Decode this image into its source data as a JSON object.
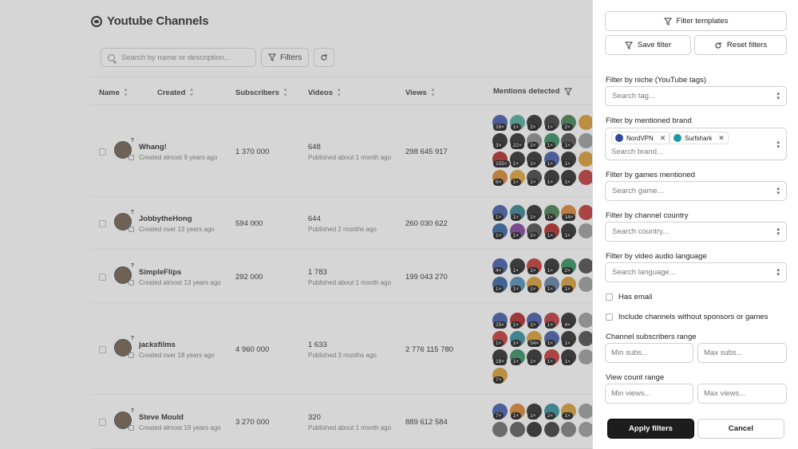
{
  "page": {
    "title": "Youtube Channels"
  },
  "toolbar": {
    "search_placeholder": "Search by name or description...",
    "filters_label": "Filters"
  },
  "table": {
    "headers": {
      "name": "Name",
      "created": "Created",
      "subscribers": "Subscribers",
      "videos": "Videos",
      "views": "Views",
      "mentions": "Mentions detected"
    },
    "rows": [
      {
        "name": "Whang!",
        "created": "Created almost 9 years ago",
        "subscribers": "1 370 000",
        "videos": "648",
        "videos_sub": "Published about 1 month ago",
        "views": "298 645 917",
        "mentions": [
          {
            "c": "#3a55a6",
            "n": "26"
          },
          {
            "c": "#4aa89a",
            "n": "1"
          },
          {
            "c": "#222",
            "n": "2"
          },
          {
            "c": "#333",
            "n": "1"
          },
          {
            "c": "#3d7a4a",
            "n": "2"
          },
          {
            "c": "#d79a2b",
            "n": ""
          },
          {
            "c": "#222",
            "n": "3"
          },
          {
            "c": "#222",
            "n": "22"
          },
          {
            "c": "#888",
            "n": "1"
          },
          {
            "c": "#2a8a5a",
            "n": "1"
          },
          {
            "c": "#444",
            "n": "1"
          },
          {
            "c": "#999",
            "n": ""
          },
          {
            "c": "#b01e1e",
            "n": "155"
          },
          {
            "c": "#222",
            "n": "1"
          },
          {
            "c": "#222",
            "n": "1"
          },
          {
            "c": "#3a55a6",
            "n": "1"
          },
          {
            "c": "#222",
            "n": "1"
          },
          {
            "c": "#d79a2b",
            "n": ""
          },
          {
            "c": "#d8802a",
            "n": "6"
          },
          {
            "c": "#e0a030",
            "n": "1"
          },
          {
            "c": "#3a3a3a",
            "n": "1"
          },
          {
            "c": "#222",
            "n": "1"
          },
          {
            "c": "#222",
            "n": "1"
          },
          {
            "c": "#c23030",
            "n": ""
          }
        ]
      },
      {
        "name": "JobbytheHong",
        "created": "Created over 13 years ago",
        "subscribers": "594 000",
        "videos": "644",
        "videos_sub": "Published 2 months ago",
        "views": "260 030 622",
        "mentions": [
          {
            "c": "#3a55a6",
            "n": "1"
          },
          {
            "c": "#2c7c8c",
            "n": "1"
          },
          {
            "c": "#222",
            "n": "1"
          },
          {
            "c": "#3d7a4a",
            "n": "1"
          },
          {
            "c": "#d8802a",
            "n": "14"
          },
          {
            "c": "#c23030",
            "n": ""
          },
          {
            "c": "#2c5c9c",
            "n": "1"
          },
          {
            "c": "#7a3a9a",
            "n": "1"
          },
          {
            "c": "#444",
            "n": "1"
          },
          {
            "c": "#b01e1e",
            "n": "1"
          },
          {
            "c": "#222",
            "n": "1"
          },
          {
            "c": "#999",
            "n": ""
          }
        ]
      },
      {
        "name": "SimpleFlips",
        "created": "Created almost 13 years ago",
        "subscribers": "292 000",
        "videos": "1 783",
        "videos_sub": "Published about 1 month ago",
        "views": "199 043 270",
        "mentions": [
          {
            "c": "#3a55a6",
            "n": "4"
          },
          {
            "c": "#222",
            "n": "1"
          },
          {
            "c": "#c23030",
            "n": "1"
          },
          {
            "c": "#222",
            "n": "1"
          },
          {
            "c": "#2a8a5a",
            "n": "2"
          },
          {
            "c": "#444",
            "n": ""
          },
          {
            "c": "#2c5c9c",
            "n": "1"
          },
          {
            "c": "#4a8ab0",
            "n": "1"
          },
          {
            "c": "#d79a2b",
            "n": "1"
          },
          {
            "c": "#5a7aa0",
            "n": "1"
          },
          {
            "c": "#d79a2b",
            "n": "1"
          },
          {
            "c": "#999",
            "n": ""
          }
        ]
      },
      {
        "name": "jacksfilms",
        "created": "Created over 18 years ago",
        "subscribers": "4 960 000",
        "videos": "1 633",
        "videos_sub": "Published 3 months ago",
        "views": "2 776 115 780",
        "mentions": [
          {
            "c": "#3a55a6",
            "n": "25"
          },
          {
            "c": "#b01e1e",
            "n": "1"
          },
          {
            "c": "#3a55a6",
            "n": "1"
          },
          {
            "c": "#c23030",
            "n": "1"
          },
          {
            "c": "#222",
            "n": "4"
          },
          {
            "c": "#999",
            "n": ""
          },
          {
            "c": "#c23030",
            "n": "1"
          },
          {
            "c": "#2a8a9a",
            "n": "1"
          },
          {
            "c": "#d79a2b",
            "n": "54"
          },
          {
            "c": "#3a55a6",
            "n": "1"
          },
          {
            "c": "#222",
            "n": "1"
          },
          {
            "c": "#444",
            "n": ""
          },
          {
            "c": "#222",
            "n": "18"
          },
          {
            "c": "#2a8a5a",
            "n": "1"
          },
          {
            "c": "#222",
            "n": "1"
          },
          {
            "c": "#c23030",
            "n": "1"
          },
          {
            "c": "#222",
            "n": "1"
          },
          {
            "c": "#999",
            "n": ""
          },
          {
            "c": "#d79a2b",
            "n": "7"
          }
        ]
      },
      {
        "name": "Steve Mould",
        "created": "Created almost 19 years ago",
        "subscribers": "3 270 000",
        "videos": "320",
        "videos_sub": "Published about 1 month ago",
        "views": "889 612 584",
        "mentions": [
          {
            "c": "#3a55a6",
            "n": "7"
          },
          {
            "c": "#d8802a",
            "n": "1"
          },
          {
            "c": "#222",
            "n": "1"
          },
          {
            "c": "#2a8a9a",
            "n": "2"
          },
          {
            "c": "#d79a2b",
            "n": "1"
          },
          {
            "c": "#999",
            "n": ""
          },
          {
            "c": "#666",
            "n": ""
          },
          {
            "c": "#555",
            "n": ""
          },
          {
            "c": "#222",
            "n": ""
          },
          {
            "c": "#333",
            "n": ""
          },
          {
            "c": "#777",
            "n": ""
          },
          {
            "c": "#999",
            "n": ""
          }
        ]
      }
    ]
  },
  "panel": {
    "templates_label": "Filter templates",
    "save_label": "Save filter",
    "reset_label": "Reset filters",
    "niche_label": "Filter by niche (YouTube tags)",
    "niche_placeholder": "Search tag...",
    "brand_label": "Filter by mentioned brand",
    "brand_chips": [
      {
        "name": "NordVPN",
        "color": "#2d4aa0"
      },
      {
        "name": "Surfshark",
        "color": "#1c9aa6"
      }
    ],
    "brand_placeholder": "Search brand...",
    "games_label": "Filter by games mentioned",
    "games_placeholder": "Search game...",
    "country_label": "Filter by channel country",
    "country_placeholder": "Search country...",
    "language_label": "Filter by video audio language",
    "language_placeholder": "Search language...",
    "has_email_label": "Has email",
    "include_label": "Include channels without sponsors or games",
    "subs_range_label": "Channel subscribers range",
    "min_subs_placeholder": "Min subs...",
    "max_subs_placeholder": "Max subs...",
    "views_range_label": "View count range",
    "min_views_placeholder": "Min views...",
    "max_views_placeholder": "Max views...",
    "apply_label": "Apply filters",
    "cancel_label": "Cancel"
  }
}
